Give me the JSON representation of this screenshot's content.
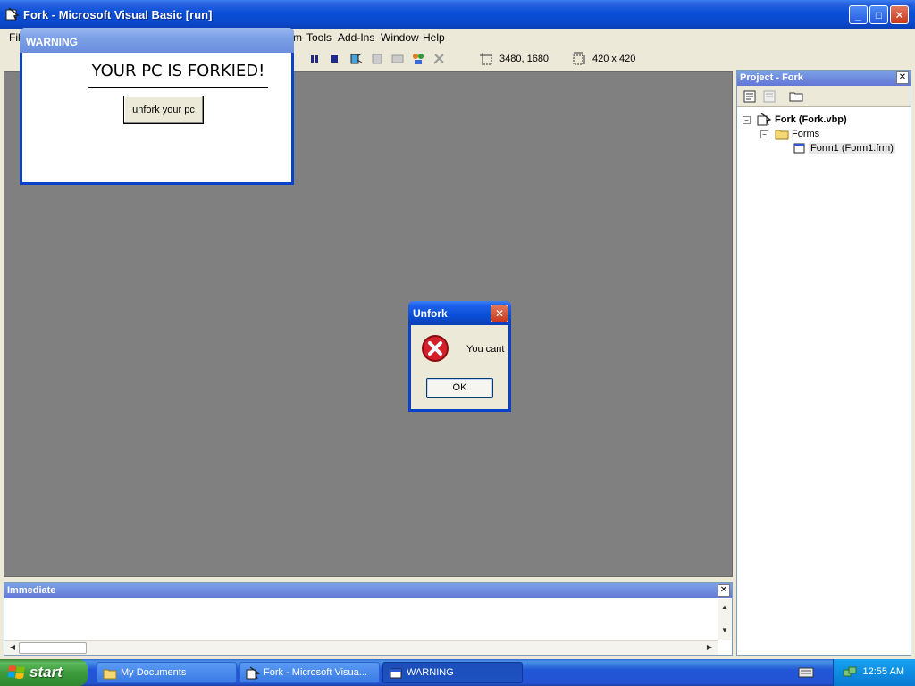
{
  "window": {
    "title": "Fork - Microsoft Visual Basic [run]"
  },
  "menu": {
    "file": "File",
    "m_partial": "m",
    "tools": "Tools",
    "addins": "Add-Ins",
    "window": "Window",
    "help": "Help"
  },
  "toolbar": {
    "position": "3480, 1680",
    "size": "420 x 420"
  },
  "project": {
    "title": "Project - Fork",
    "root": "Fork (Fork.vbp)",
    "folder": "Forms",
    "item": "Form1 (Form1.frm)"
  },
  "immediate": {
    "title": "Immediate"
  },
  "warning_form": {
    "title": "WARNING",
    "headline": "YOUR PC IS FORKIED!",
    "button": "unfork your pc"
  },
  "msgbox": {
    "title": "Unfork",
    "message": "You cant",
    "ok": "OK"
  },
  "taskbar": {
    "start": "start",
    "tasks": [
      "My Documents",
      "Fork - Microsoft Visua...",
      "WARNING"
    ],
    "clock": "12:55 AM"
  },
  "colors": {
    "titlebar_blue": "#0a4fd8",
    "mdi_gray": "#808080",
    "start_green": "#3c9c3c",
    "error_red": "#d4202a"
  }
}
